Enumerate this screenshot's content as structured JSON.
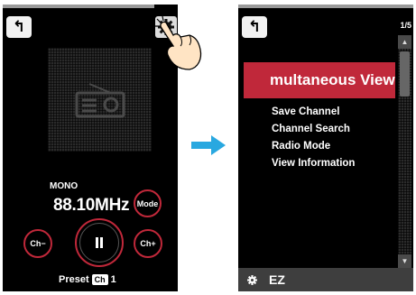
{
  "colors": {
    "accent": "#c0283a",
    "arrow": "#29a8e0",
    "screen": "#000000"
  },
  "left_screen": {
    "back_icon": "back-arrow-icon",
    "settings_icon": "gear-icon",
    "art_icon": "radio-icon",
    "mode_label": "MONO",
    "frequency": "88.10MHz",
    "mode_button": "Mode",
    "ch_minus_button": "Ch−",
    "ch_plus_button": "Ch+",
    "play_icon": "pause-icon",
    "preset_label": "Preset",
    "preset_badge": "Ch",
    "preset_number": "1"
  },
  "right_screen": {
    "back_icon": "back-arrow-icon",
    "page_counter": "1/5",
    "highlighted_item": "multaneous View",
    "menu_items": [
      "Save Channel",
      "Channel Search",
      "Radio Mode",
      "View Information"
    ],
    "bottom_bar": {
      "icon": "gear-icon",
      "label": "EZ"
    }
  }
}
